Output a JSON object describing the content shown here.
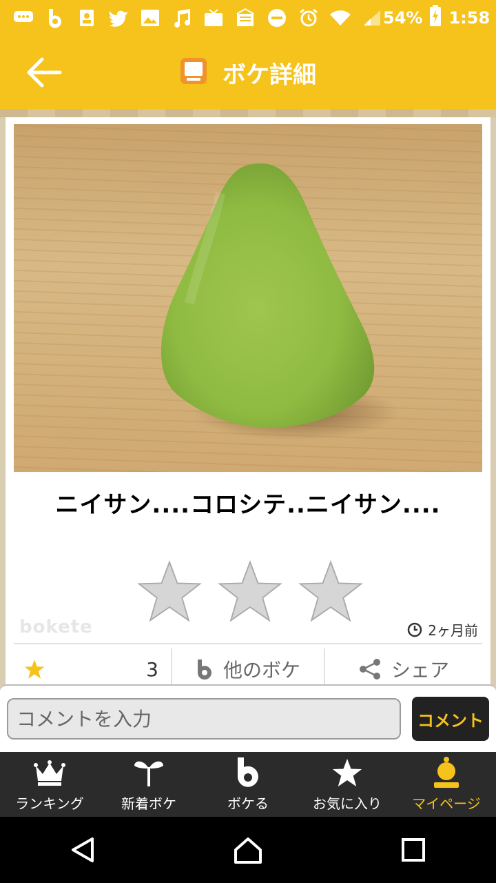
{
  "status_bar": {
    "battery": "54%",
    "time": "1:58",
    "icons": [
      "message-icon",
      "b-icon",
      "contact-icon",
      "twitter-icon",
      "image-icon",
      "music-icon",
      "tv-icon",
      "mail-icon",
      "dnd-icon",
      "alarm-icon",
      "wifi-icon",
      "signal-icon",
      "battery-icon"
    ]
  },
  "app_bar": {
    "title": "ボケ詳細",
    "back_icon": "arrow-left-icon",
    "title_icon": "tv-icon"
  },
  "post": {
    "boke_text": "ニイサン....コロシテ..ニイサン....",
    "logo": "bokete",
    "posted": "2ヶ月前",
    "rating_stars": 3,
    "favorites_count": "3",
    "other_boke_label": "他のボケ",
    "share_label": "シェア"
  },
  "comment": {
    "placeholder": "コメントを入力",
    "button_label": "コメント"
  },
  "bottom_nav": {
    "items": [
      {
        "label": "ランキング",
        "icon": "crown-icon"
      },
      {
        "label": "新着ボケ",
        "icon": "sprout-icon"
      },
      {
        "label": "ボケる",
        "icon": "b-logo-icon"
      },
      {
        "label": "お気に入り",
        "icon": "star-icon"
      },
      {
        "label": "マイページ",
        "icon": "profile-icon"
      }
    ],
    "active_index": 4
  },
  "colors": {
    "accent": "#f5c31c",
    "nav_bg": "#2b2b2b",
    "star_gold": "#f5c31c",
    "star_gray": "#d6d6d6"
  }
}
